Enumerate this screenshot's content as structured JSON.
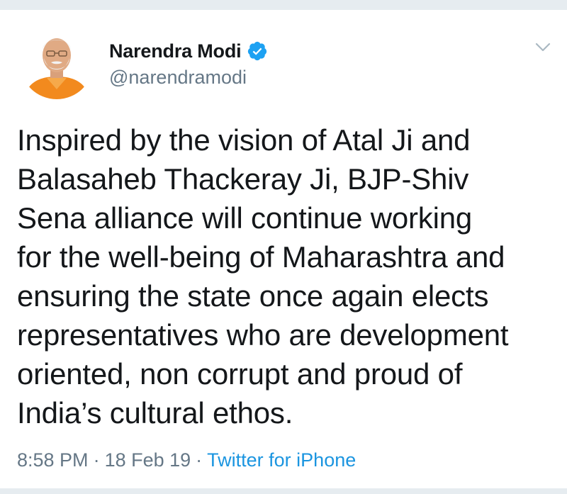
{
  "author": {
    "display_name": "Narendra Modi",
    "handle": "@narendramodi",
    "verified": true,
    "verified_icon": "verified-badge-icon",
    "verified_color": "#1da1f2"
  },
  "tweet": {
    "text": "Inspired by the vision of Atal Ji and\nBalasaheb Thackeray Ji, BJP-Shiv\nSena alliance will continue working\nfor the well-being of Maharashtra and\nensuring the state once again elects\nrepresentatives who are development\noriented, non corrupt and proud of\nIndia’s cultural ethos."
  },
  "meta": {
    "time": "8:58 PM",
    "separator": "·",
    "date": "18 Feb 19",
    "source": "Twitter for iPhone"
  },
  "colors": {
    "text": "#14171a",
    "secondary": "#657786",
    "link": "#1b95e0",
    "divider": "#e6ecf0"
  },
  "icons": {
    "menu": "chevron-down-icon",
    "avatar": "avatar"
  }
}
